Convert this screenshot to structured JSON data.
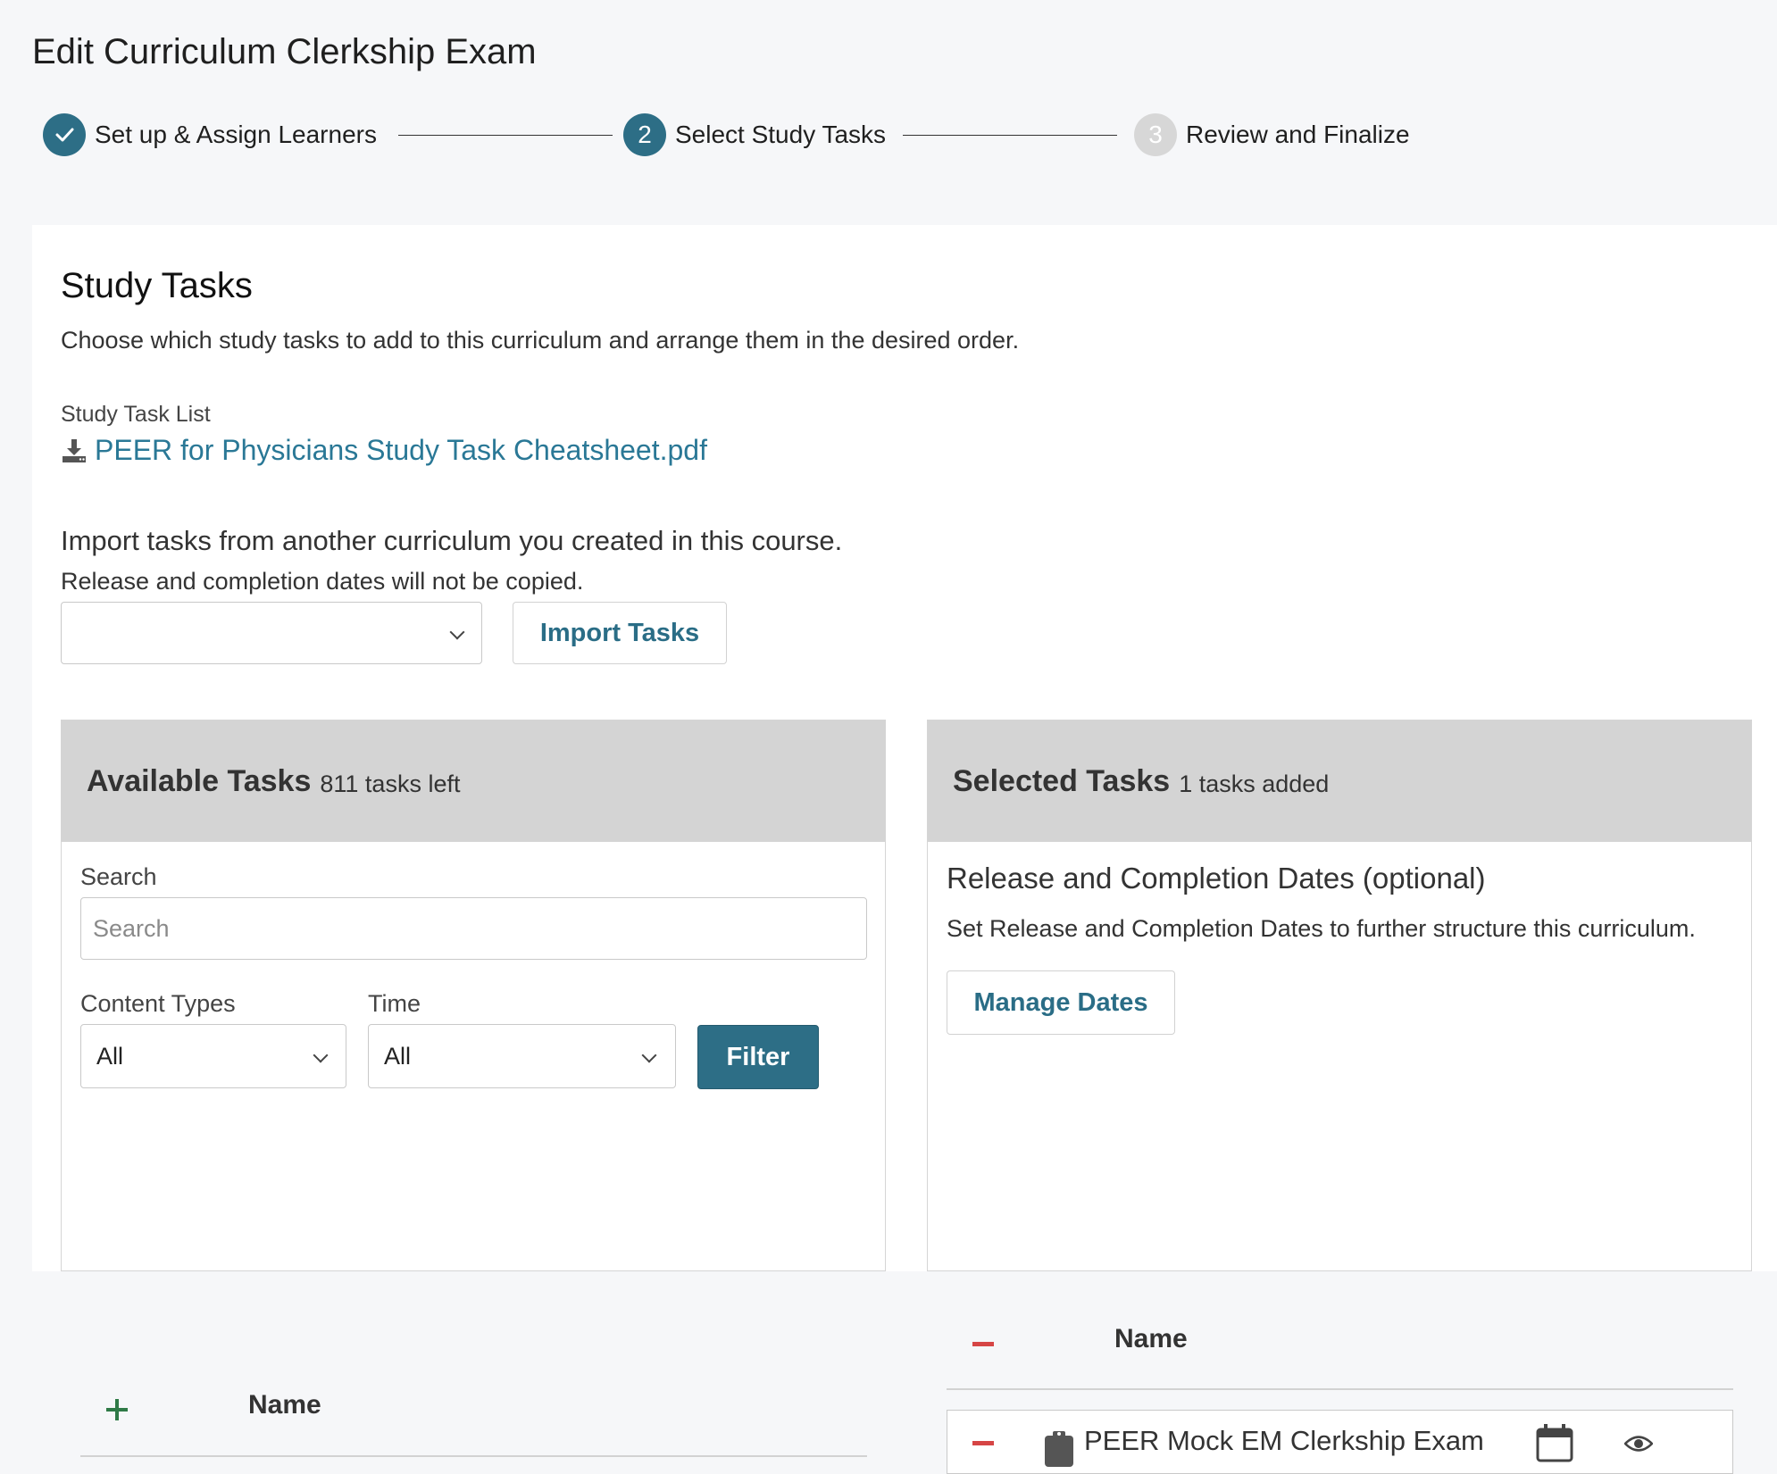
{
  "page": {
    "title": "Edit Curriculum Clerkship Exam"
  },
  "stepper": {
    "steps": [
      {
        "label": "Set up & Assign Learners",
        "status": "complete",
        "number": "1"
      },
      {
        "label": "Select Study Tasks",
        "status": "active",
        "number": "2"
      },
      {
        "label": "Review and Finalize",
        "status": "pending",
        "number": "3"
      }
    ],
    "colors": {
      "active": "#2d6e86",
      "pending": "#d7d7d7"
    }
  },
  "study_tasks": {
    "title": "Study Tasks",
    "description": "Choose which study tasks to add to this curriculum and arrange them in the desired order.",
    "list_label": "Study Task List",
    "pdf_link": "PEER for Physicians Study Task Cheatsheet.pdf",
    "import_heading": "Import tasks from another curriculum you created in this course.",
    "import_note": "Release and completion dates will not be copied.",
    "import_select_value": "",
    "import_button": "Import Tasks"
  },
  "available": {
    "title": "Available Tasks",
    "count": "811 tasks left",
    "search_label": "Search",
    "search_placeholder": "Search",
    "content_types_label": "Content Types",
    "content_types_value": "All",
    "time_label": "Time",
    "time_value": "All",
    "filter_button": "Filter",
    "name_header": "Name"
  },
  "selected": {
    "title": "Selected Tasks",
    "count": "1 tasks added",
    "dates_title": "Release and Completion Dates (optional)",
    "dates_desc": "Set Release and Completion Dates to further structure this curriculum.",
    "manage_dates_button": "Manage Dates",
    "name_header": "Name",
    "tasks": [
      {
        "name": "PEER Mock EM Clerkship Exam",
        "icon": "clipboard-icon"
      }
    ]
  },
  "theme": {
    "accent": "#2d6e86",
    "link": "#2a7896",
    "add": "#2f7a47",
    "remove": "#d64545"
  }
}
